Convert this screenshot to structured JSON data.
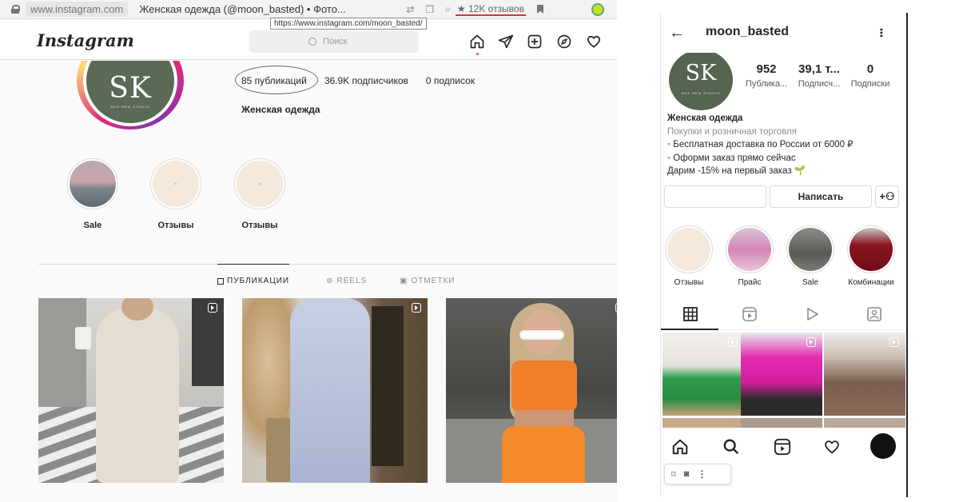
{
  "browser": {
    "url": "www.instagram.com",
    "tab_title": "Женская одежда (@moon_basted) • Фото...",
    "tooltip": "https://www.instagram.com/moon_basted/",
    "reviews": "★ 12K отзывов"
  },
  "desktop": {
    "logo": "Instagram",
    "search_placeholder": "Поиск",
    "nav_icons": [
      "home-icon",
      "direct-icon",
      "new-post-icon",
      "explore-icon",
      "heart-icon"
    ],
    "avatar_mono": "SK",
    "avatar_small": "SKS NEW STUDIO",
    "stats": {
      "posts": "85 публикаций",
      "followers": "36.9K подписчиков",
      "following": "0 подписок"
    },
    "bio_name": "Женская одежда",
    "highlights": [
      {
        "label": "Sale"
      },
      {
        "label": "Отзывы"
      },
      {
        "label": "Отзывы"
      }
    ],
    "tabs": {
      "posts": "ПУБЛИКАЦИИ",
      "reels": "REELS",
      "tagged": "ОТМЕТКИ"
    }
  },
  "mobile": {
    "username": "moon_basted",
    "avatar_mono": "SK",
    "avatar_small": "SKS NEW STUDIO",
    "stats": [
      {
        "value": "952",
        "label": "Публика..."
      },
      {
        "value": "39,1 т...",
        "label": "Подписч..."
      },
      {
        "value": "0",
        "label": "Подписки"
      }
    ],
    "bio": {
      "name": "Женская одежда",
      "category": "Покупки и розничная торговля",
      "line1": "◦ Бесплатная доставка по России от 6000 ₽",
      "line2": "◦ Оформи заказ прямо сейчас",
      "line3": "Дарим -15% на первый заказ 🌱"
    },
    "message_button": "Написать",
    "highlights": [
      {
        "label": "Отзывы"
      },
      {
        "label": "Прайс"
      },
      {
        "label": "Sale"
      },
      {
        "label": "Комбинации"
      }
    ]
  },
  "colors": {
    "avatar_green": "#5a6a55",
    "link_blue": "#0095f6",
    "accent_orange": "#f07d2a"
  }
}
